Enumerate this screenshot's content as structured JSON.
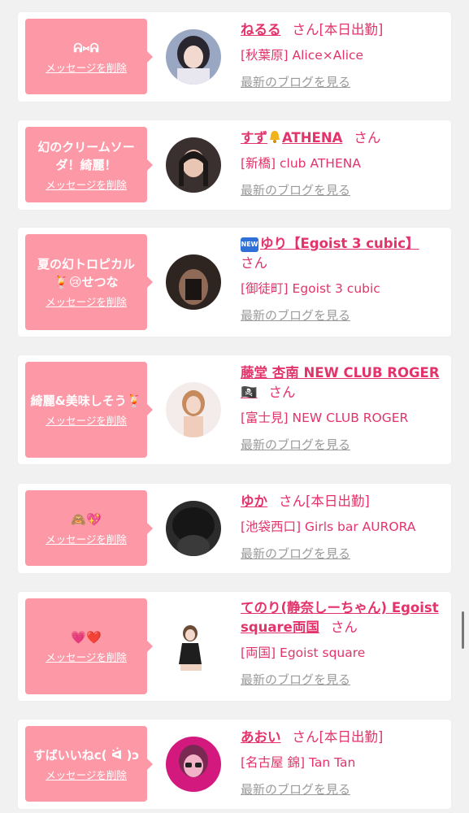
{
  "delete_label": "メッセージを削除",
  "blog_label": "最新のブログを見る",
  "san_label": "さん",
  "new_badge": "NEW",
  "accent_color": "#e2336b",
  "bubble_color": "#fd98a7",
  "items": [
    {
      "message": "ᕱ⑅︎ᕱ",
      "name": "ねるる",
      "status": "[本日出勤]",
      "shop": "[秋葉原] Alice×Alice",
      "avatar_icon": "girl-avatar"
    },
    {
      "message": "幻のクリームソーダ！綺麗！",
      "name_pre": "すず",
      "name_post": "ATHENA",
      "shop": "[新橋] club ATHENA",
      "avatar_icon": "girl-avatar"
    },
    {
      "message": "夏の幻トロピカル🍹😢せつな",
      "name": "ゆり【Egoist 3 cubic】",
      "shop": "[御徒町] Egoist 3 cubic",
      "avatar_icon": "girl-avatar"
    },
    {
      "message": "綺麗&美味しそう🍹",
      "name": "藤堂 杏南 NEW CLUB ROGER🏴‍☠️",
      "shop": "[富士見] NEW CLUB ROGER",
      "avatar_icon": "girl-avatar"
    },
    {
      "message": "🙈💖",
      "name": "ゆか",
      "status": "[本日出勤]",
      "shop": "[池袋西口] Girls bar AURORA",
      "avatar_icon": "girl-avatar"
    },
    {
      "message": "💗❤️",
      "name": "てのり(静奈しーちゃん) Egoist square両国",
      "shop": "[両国] Egoist square",
      "avatar_icon": "girl-avatar"
    },
    {
      "message": "すばいいねc( ᐛ )ɔ",
      "name": "あおい",
      "status": "[本日出勤]",
      "shop": "[名古屋 錦] Tan Tan",
      "avatar_icon": "girl-avatar"
    }
  ]
}
